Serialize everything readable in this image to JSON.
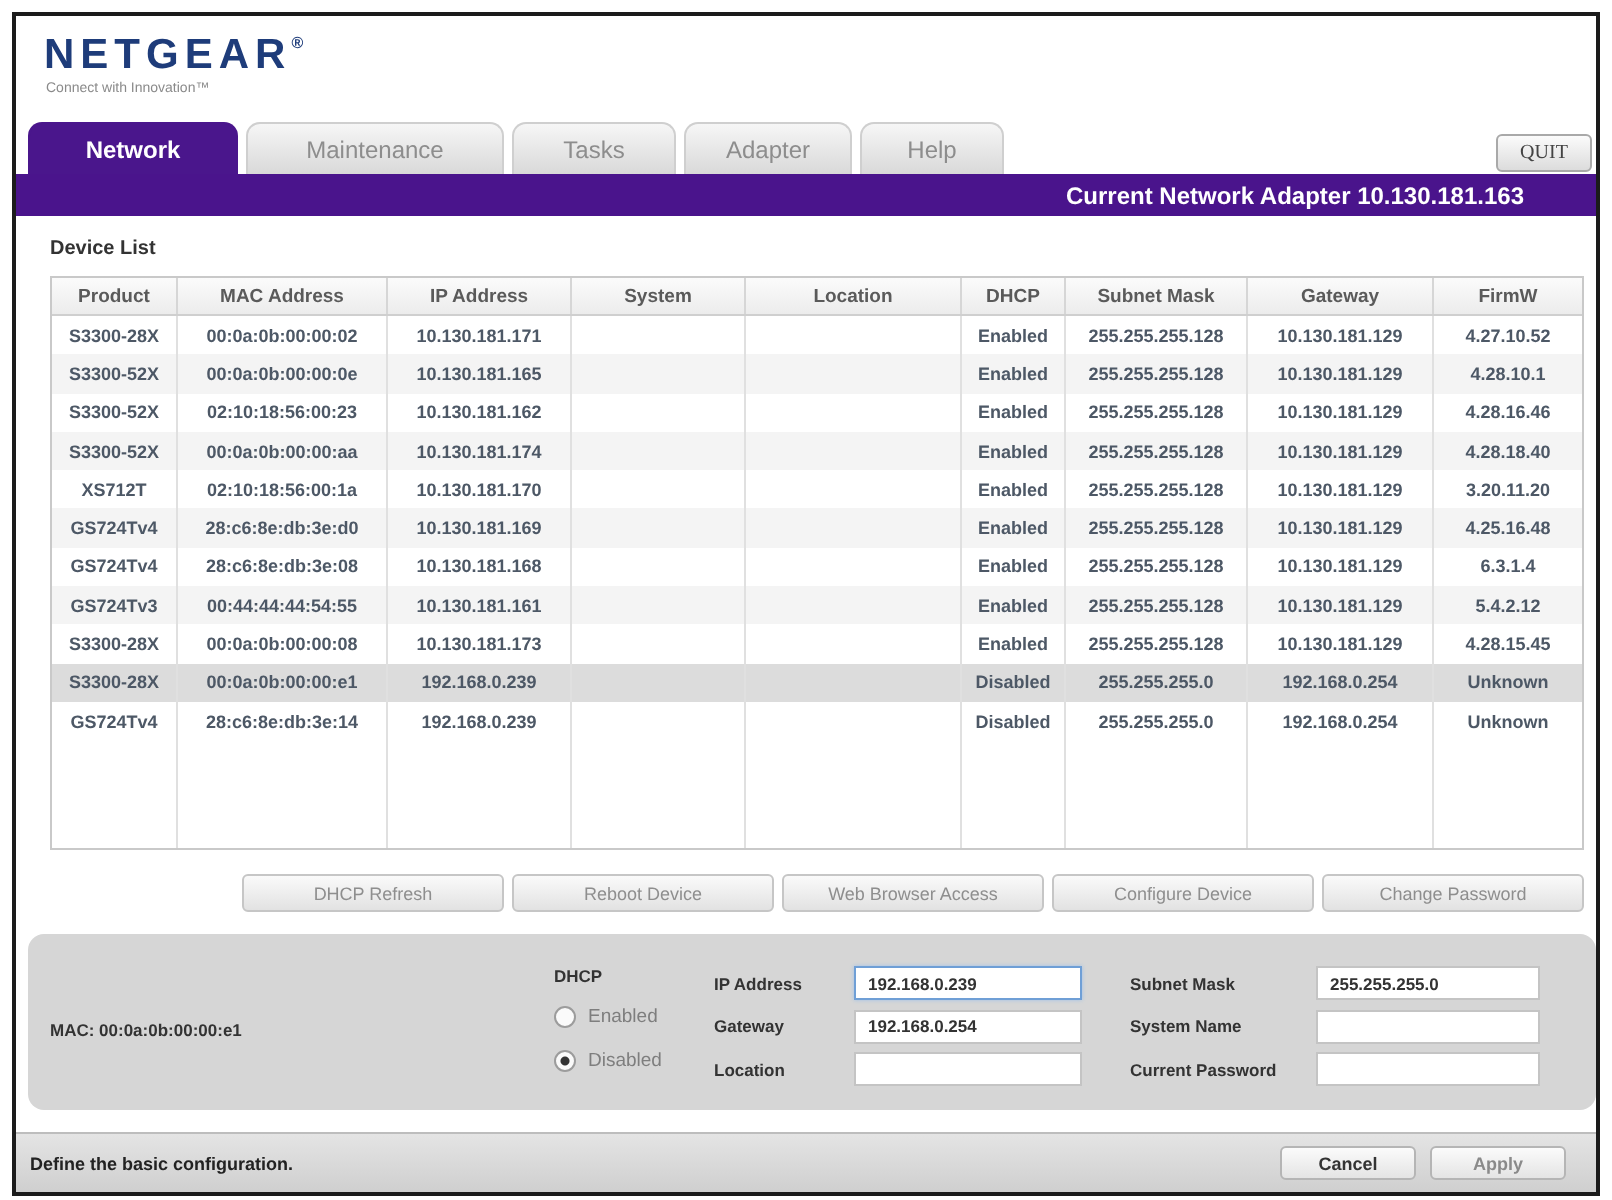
{
  "header": {
    "logo": {
      "wordmark": "NETGEAR$^{®}$",
      "tagline": "Connect with Innovation™"
    }
  },
  "tabs": [
    {
      "label": "Network",
      "selected": true
    },
    {
      "label": "Maintenance",
      "selected": false
    },
    {
      "label": "Tasks",
      "selected": false
    },
    {
      "label": "Adapter",
      "selected": false
    },
    {
      "label": "Help",
      "selected": false
    }
  ],
  "quit_button": {
    "label": "QUIT"
  },
  "adapter_bar": {
    "text": "Current Network Adapter 10.130.181.163"
  },
  "device_list": {
    "title": "Device List",
    "columns": [
      "Product",
      "MAC Address",
      "IP Address",
      "System",
      "Location",
      "DHCP",
      "Subnet Mask",
      "Gateway",
      "FirmW"
    ],
    "rows": [
      {
        "cells": [
          "S3300-28X",
          "00:0a:0b:00:00:02",
          "10.130.181.171",
          null,
          null,
          "Enabled",
          "255.255.255.128",
          "10.130.181.129",
          "4.27.10.52"
        ],
        "selected": false
      },
      {
        "cells": [
          "S3300-52X",
          "00:0a:0b:00:00:0e",
          "10.130.181.165",
          null,
          null,
          "Enabled",
          "255.255.255.128",
          "10.130.181.129",
          "4.28.10.1"
        ],
        "selected": false
      },
      {
        "cells": [
          "S3300-52X",
          "02:10:18:56:00:23",
          "10.130.181.162",
          null,
          null,
          "Enabled",
          "255.255.255.128",
          "10.130.181.129",
          "4.28.16.46"
        ],
        "selected": false
      },
      {
        "cells": [
          "S3300-52X",
          "00:0a:0b:00:00:aa",
          "10.130.181.174",
          null,
          null,
          "Enabled",
          "255.255.255.128",
          "10.130.181.129",
          "4.28.18.40"
        ],
        "selected": false
      },
      {
        "cells": [
          "XS712T",
          "02:10:18:56:00:1a",
          "10.130.181.170",
          null,
          null,
          "Enabled",
          "255.255.255.128",
          "10.130.181.129",
          "3.20.11.20"
        ],
        "selected": false
      },
      {
        "cells": [
          "GS724Tv4",
          "28:c6:8e:db:3e:d0",
          "10.130.181.169",
          null,
          null,
          "Enabled",
          "255.255.255.128",
          "10.130.181.129",
          "4.25.16.48"
        ],
        "selected": false
      },
      {
        "cells": [
          "GS724Tv4",
          "28:c6:8e:db:3e:08",
          "10.130.181.168",
          null,
          null,
          "Enabled",
          "255.255.255.128",
          "10.130.181.129",
          "6.3.1.4"
        ],
        "selected": false
      },
      {
        "cells": [
          "GS724Tv3",
          "00:44:44:44:54:55",
          "10.130.181.161",
          null,
          null,
          "Enabled",
          "255.255.255.128",
          "10.130.181.129",
          "5.4.2.12"
        ],
        "selected": false
      },
      {
        "cells": [
          "S3300-28X",
          "00:0a:0b:00:00:08",
          "10.130.181.173",
          null,
          null,
          "Enabled",
          "255.255.255.128",
          "10.130.181.129",
          "4.28.15.45"
        ],
        "selected": false
      },
      {
        "cells": [
          "S3300-28X",
          "00:0a:0b:00:00:e1",
          "192.168.0.239",
          null,
          null,
          "Disabled",
          "255.255.255.0",
          "192.168.0.254",
          "Unknown"
        ],
        "selected": true
      },
      {
        "cells": [
          "GS724Tv4",
          "28:c6:8e:db:3e:14",
          "192.168.0.239",
          null,
          null,
          "Disabled",
          "255.255.255.0",
          "192.168.0.254",
          "Unknown"
        ],
        "selected": false
      }
    ]
  },
  "device_actions": [
    {
      "label": "DHCP Refresh",
      "disabled": true
    },
    {
      "label": "Reboot Device",
      "disabled": true
    },
    {
      "label": "Web Browser Access",
      "disabled": true
    },
    {
      "label": "Configure Device",
      "disabled": true
    },
    {
      "label": "Change Password",
      "disabled": true
    }
  ],
  "config_panel": {
    "mac": "MAC: 00:0a:0b:00:00:e1",
    "dhcp": {
      "label": "DHCP",
      "options": [
        {
          "label": "Enabled",
          "selected": false
        },
        {
          "label": "Disabled",
          "selected": true
        }
      ]
    },
    "field_columns": [
      [
        {
          "label": "IP Address",
          "value": "192.168.0.239",
          "focused": true
        },
        {
          "label": "Gateway",
          "value": "192.168.0.254",
          "focused": false
        },
        {
          "label": "Location",
          "focused": false
        }
      ],
      [
        {
          "label": "Subnet Mask",
          "value": "255.255.255.0",
          "focused": false
        },
        {
          "label": "System Name",
          "focused": false
        },
        {
          "label": "Current Password",
          "focused": false
        }
      ]
    ]
  },
  "status_bar": {
    "message": "Define the basic configuration.",
    "buttons": [
      {
        "label": "Cancel",
        "disabled": false
      },
      {
        "label": "Apply",
        "disabled": true
      }
    ]
  }
}
